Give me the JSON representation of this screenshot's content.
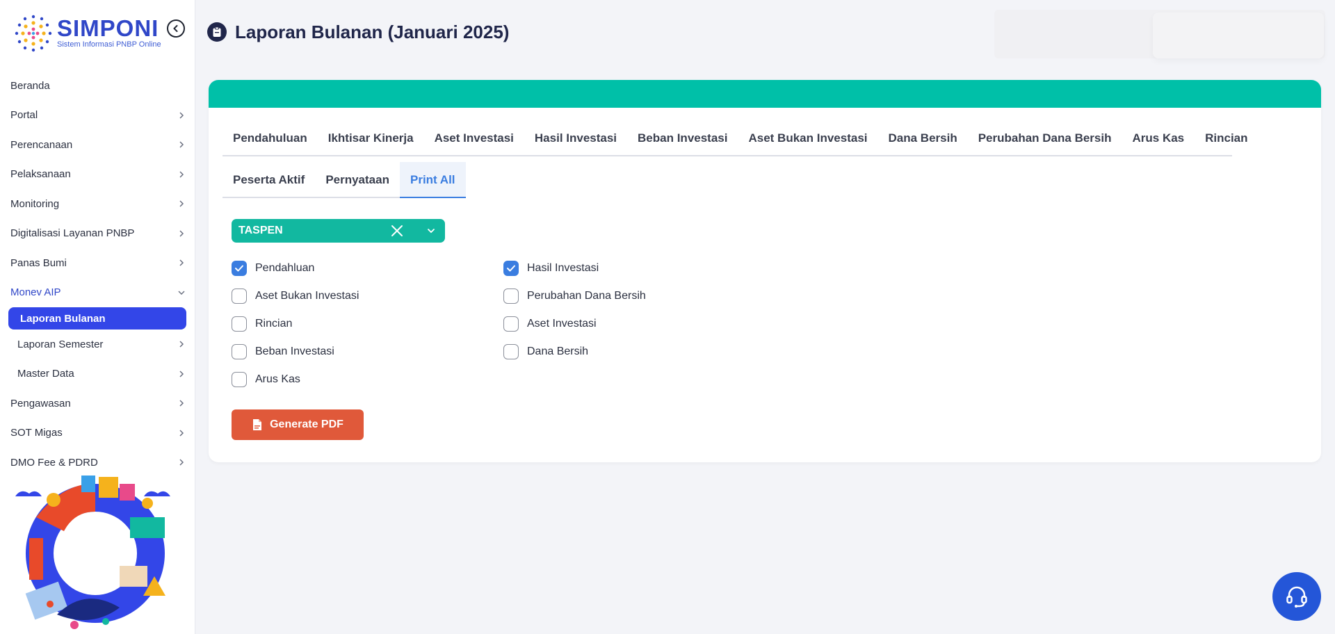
{
  "brand": {
    "name": "SIMPONI",
    "subtitle": "Sistem Informasi PNBP Online"
  },
  "sidebar": {
    "items": [
      {
        "label": "Beranda",
        "has_chevron": false
      },
      {
        "label": "Portal",
        "has_chevron": true
      },
      {
        "label": "Perencanaan",
        "has_chevron": true
      },
      {
        "label": "Pelaksanaan",
        "has_chevron": true
      },
      {
        "label": "Monitoring",
        "has_chevron": true
      },
      {
        "label": "Digitalisasi Layanan PNBP",
        "has_chevron": true
      },
      {
        "label": "Panas Bumi",
        "has_chevron": true
      },
      {
        "label": "Monev AIP",
        "has_chevron": true,
        "open": true
      }
    ],
    "submenu": {
      "active_label": "Laporan Bulanan",
      "items": [
        {
          "label": "Laporan Semester"
        },
        {
          "label": "Master Data"
        }
      ]
    },
    "items_after": [
      {
        "label": "Pengawasan"
      },
      {
        "label": "SOT Migas"
      },
      {
        "label": "DMO Fee & PDRD"
      }
    ]
  },
  "header": {
    "title": "Laporan Bulanan (Januari 2025)"
  },
  "tabs_primary": [
    "Pendahuluan",
    "Ikhtisar Kinerja",
    "Aset Investasi",
    "Hasil Investasi",
    "Beban Investasi",
    "Aset Bukan Investasi",
    "Dana Bersih",
    "Perubahan Dana Bersih",
    "Arus Kas",
    "Rincian"
  ],
  "tabs_secondary": {
    "items": [
      "Peserta Aktif",
      "Pernyataan",
      "Print All"
    ],
    "active": "Print All"
  },
  "select": {
    "value": "TASPEN"
  },
  "checkboxes": {
    "left": [
      {
        "label": "Pendahluan",
        "checked": true
      },
      {
        "label": "Aset Bukan Investasi",
        "checked": false
      },
      {
        "label": "Rincian",
        "checked": false
      },
      {
        "label": "Beban Investasi",
        "checked": false
      },
      {
        "label": "Arus Kas",
        "checked": false
      }
    ],
    "right": [
      {
        "label": "Hasil Investasi",
        "checked": true
      },
      {
        "label": "Perubahan Dana Bersih",
        "checked": false
      },
      {
        "label": "Aset Investasi",
        "checked": false
      },
      {
        "label": "Dana Bersih",
        "checked": false
      }
    ]
  },
  "actions": {
    "generate_label": "Generate PDF"
  },
  "colors": {
    "accent_teal": "#00c0a8",
    "select_teal": "#12b8a0",
    "active_blue": "#3346e8",
    "check_blue": "#3a7de0",
    "generate_orange": "#e0593a",
    "help_blue": "#2456d8"
  },
  "icons": {
    "collapse": "chevron-left-circle-icon",
    "title": "clipboard-document-icon",
    "clear": "close-icon",
    "dropdown": "chevron-down-icon",
    "generate": "pdf-file-icon",
    "help": "headset-support-icon"
  }
}
